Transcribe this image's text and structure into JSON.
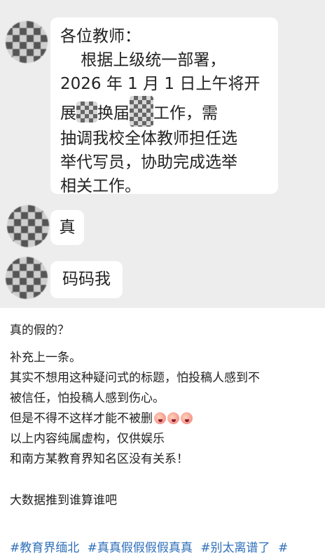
{
  "chat": {
    "message1": {
      "lines": [
        "各位教师：",
        "    根据上级统一部署，",
        "2026 年 1 月 1 日上午将开",
        "展",
        "换届",
        "工作，需",
        "抽调我校全体教师担任选",
        "举代写员，协助完成选举",
        "相关工作。"
      ]
    },
    "message2": {
      "text": "真"
    },
    "message3": {
      "text": "码码我"
    }
  },
  "post": {
    "title": "真的假的？",
    "lines": [
      "补充上一条。",
      "其实不想用这种疑问式的标题，怕投稿人感到不",
      "被信任，怕投稿人感到伤心。",
      "但是不得不这样才能不被删",
      "以上内容纯属虚构，仅供娱乐",
      "和南方某教育界知名区没有关系！"
    ],
    "closing": "大数据推到谁算谁吧",
    "emoji_icons": [
      "crying-face-icon",
      "crying-face-icon",
      "crying-face-icon"
    ]
  },
  "tags": [
    "#教育界缅北",
    "#真真假假假假真真",
    "#别太离谱了",
    "#"
  ]
}
